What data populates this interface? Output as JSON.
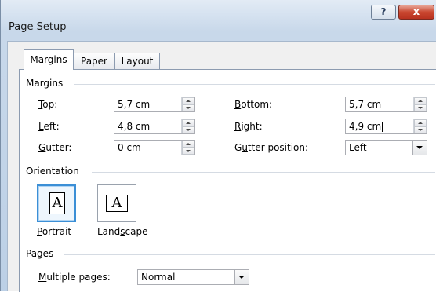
{
  "window": {
    "title": "Page Setup",
    "help_glyph": "?",
    "close_glyph": "x"
  },
  "tabs": [
    {
      "label": "Margins",
      "active": true
    },
    {
      "label": "Paper",
      "active": false
    },
    {
      "label": "Layout",
      "active": false
    }
  ],
  "margins": {
    "group_label": "Margins",
    "top": {
      "label_u": "T",
      "label_rest": "op:",
      "value": "5,7 cm"
    },
    "bottom": {
      "label_u": "B",
      "label_rest": "ottom:",
      "value": "5,7 cm"
    },
    "left": {
      "label_u": "L",
      "label_rest": "eft:",
      "value": "4,8 cm"
    },
    "right": {
      "label_u": "R",
      "label_rest": "ight:",
      "value": "4,9 cm"
    },
    "gutter": {
      "label_u": "G",
      "label_rest": "utter:",
      "value": "0 cm"
    },
    "gutter_position": {
      "label_pre": "G",
      "label_u": "u",
      "label_rest": "tter position:",
      "value": "Left"
    }
  },
  "orientation": {
    "group_label": "Orientation",
    "portrait": {
      "label_u": "P",
      "label_rest": "ortrait",
      "glyph": "A",
      "selected": true
    },
    "landscape": {
      "label_pre": "Land",
      "label_u": "s",
      "label_rest": "cape",
      "glyph": "A",
      "selected": false
    }
  },
  "pages": {
    "group_label": "Pages",
    "multiple": {
      "label_u": "M",
      "label_rest": "ultiple pages:",
      "value": "Normal"
    }
  },
  "colors": {
    "accent": "#3b8fd6",
    "close": "#c9462f"
  }
}
